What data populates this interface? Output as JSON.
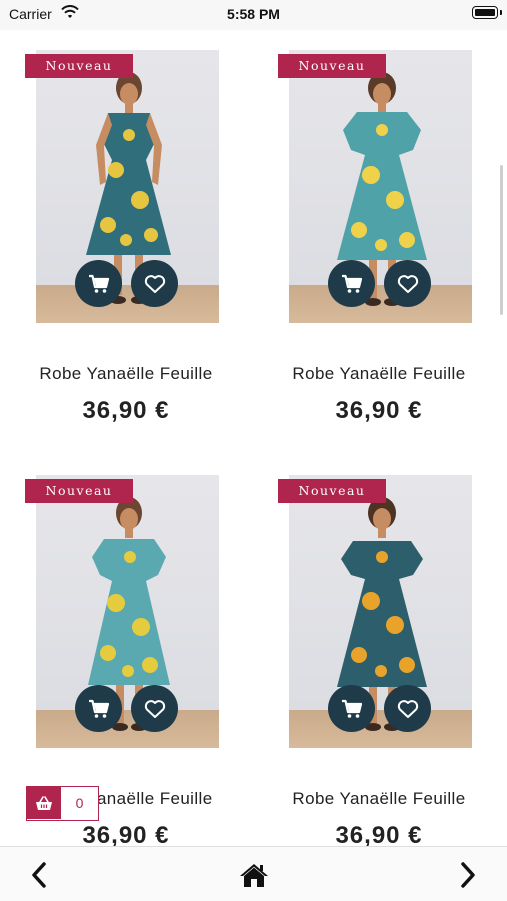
{
  "status_bar": {
    "carrier": "Carrier",
    "time": "5:58 PM"
  },
  "products": [
    {
      "badge": "Nouveau",
      "name": "Robe Yanaëlle Feuille",
      "price": "36,90 €",
      "dress_color": "#2f6e7a",
      "print_color": "#e6c640"
    },
    {
      "badge": "Nouveau",
      "name": "Robe Yanaëlle Feuille",
      "price": "36,90 €",
      "dress_color": "#4fa3a8",
      "print_color": "#f0d24a"
    },
    {
      "badge": "Nouveau",
      "name": "Robe Yanaëlle Feuille",
      "price": "36,90 €",
      "dress_color": "#5aa9b1",
      "print_color": "#e4cc3e"
    },
    {
      "badge": "Nouveau",
      "name": "Robe Yanaëlle Feuille",
      "price": "36,90 €",
      "dress_color": "#2c5f6b",
      "print_color": "#e9a32b"
    }
  ],
  "mini_cart": {
    "count": "0"
  },
  "colors": {
    "accent": "#b0254e",
    "button": "#1f3a48"
  }
}
